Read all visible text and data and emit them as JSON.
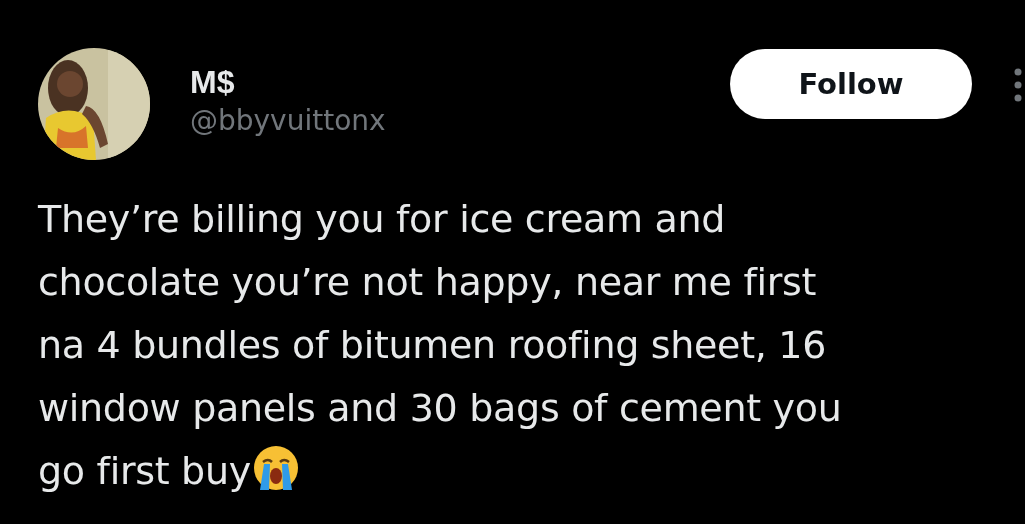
{
  "author": {
    "name": "M$",
    "handle": "@bbyvuittonx"
  },
  "follow_button": {
    "label": "Follow"
  },
  "tweet": {
    "text": "They’re billing you for ice cream and\nchocolate you’re not happy, near me first\nna 4 bundles of bitumen roofing sheet, 16\nwindow panels and 30 bags of cement you",
    "last_line": "go first buy"
  }
}
